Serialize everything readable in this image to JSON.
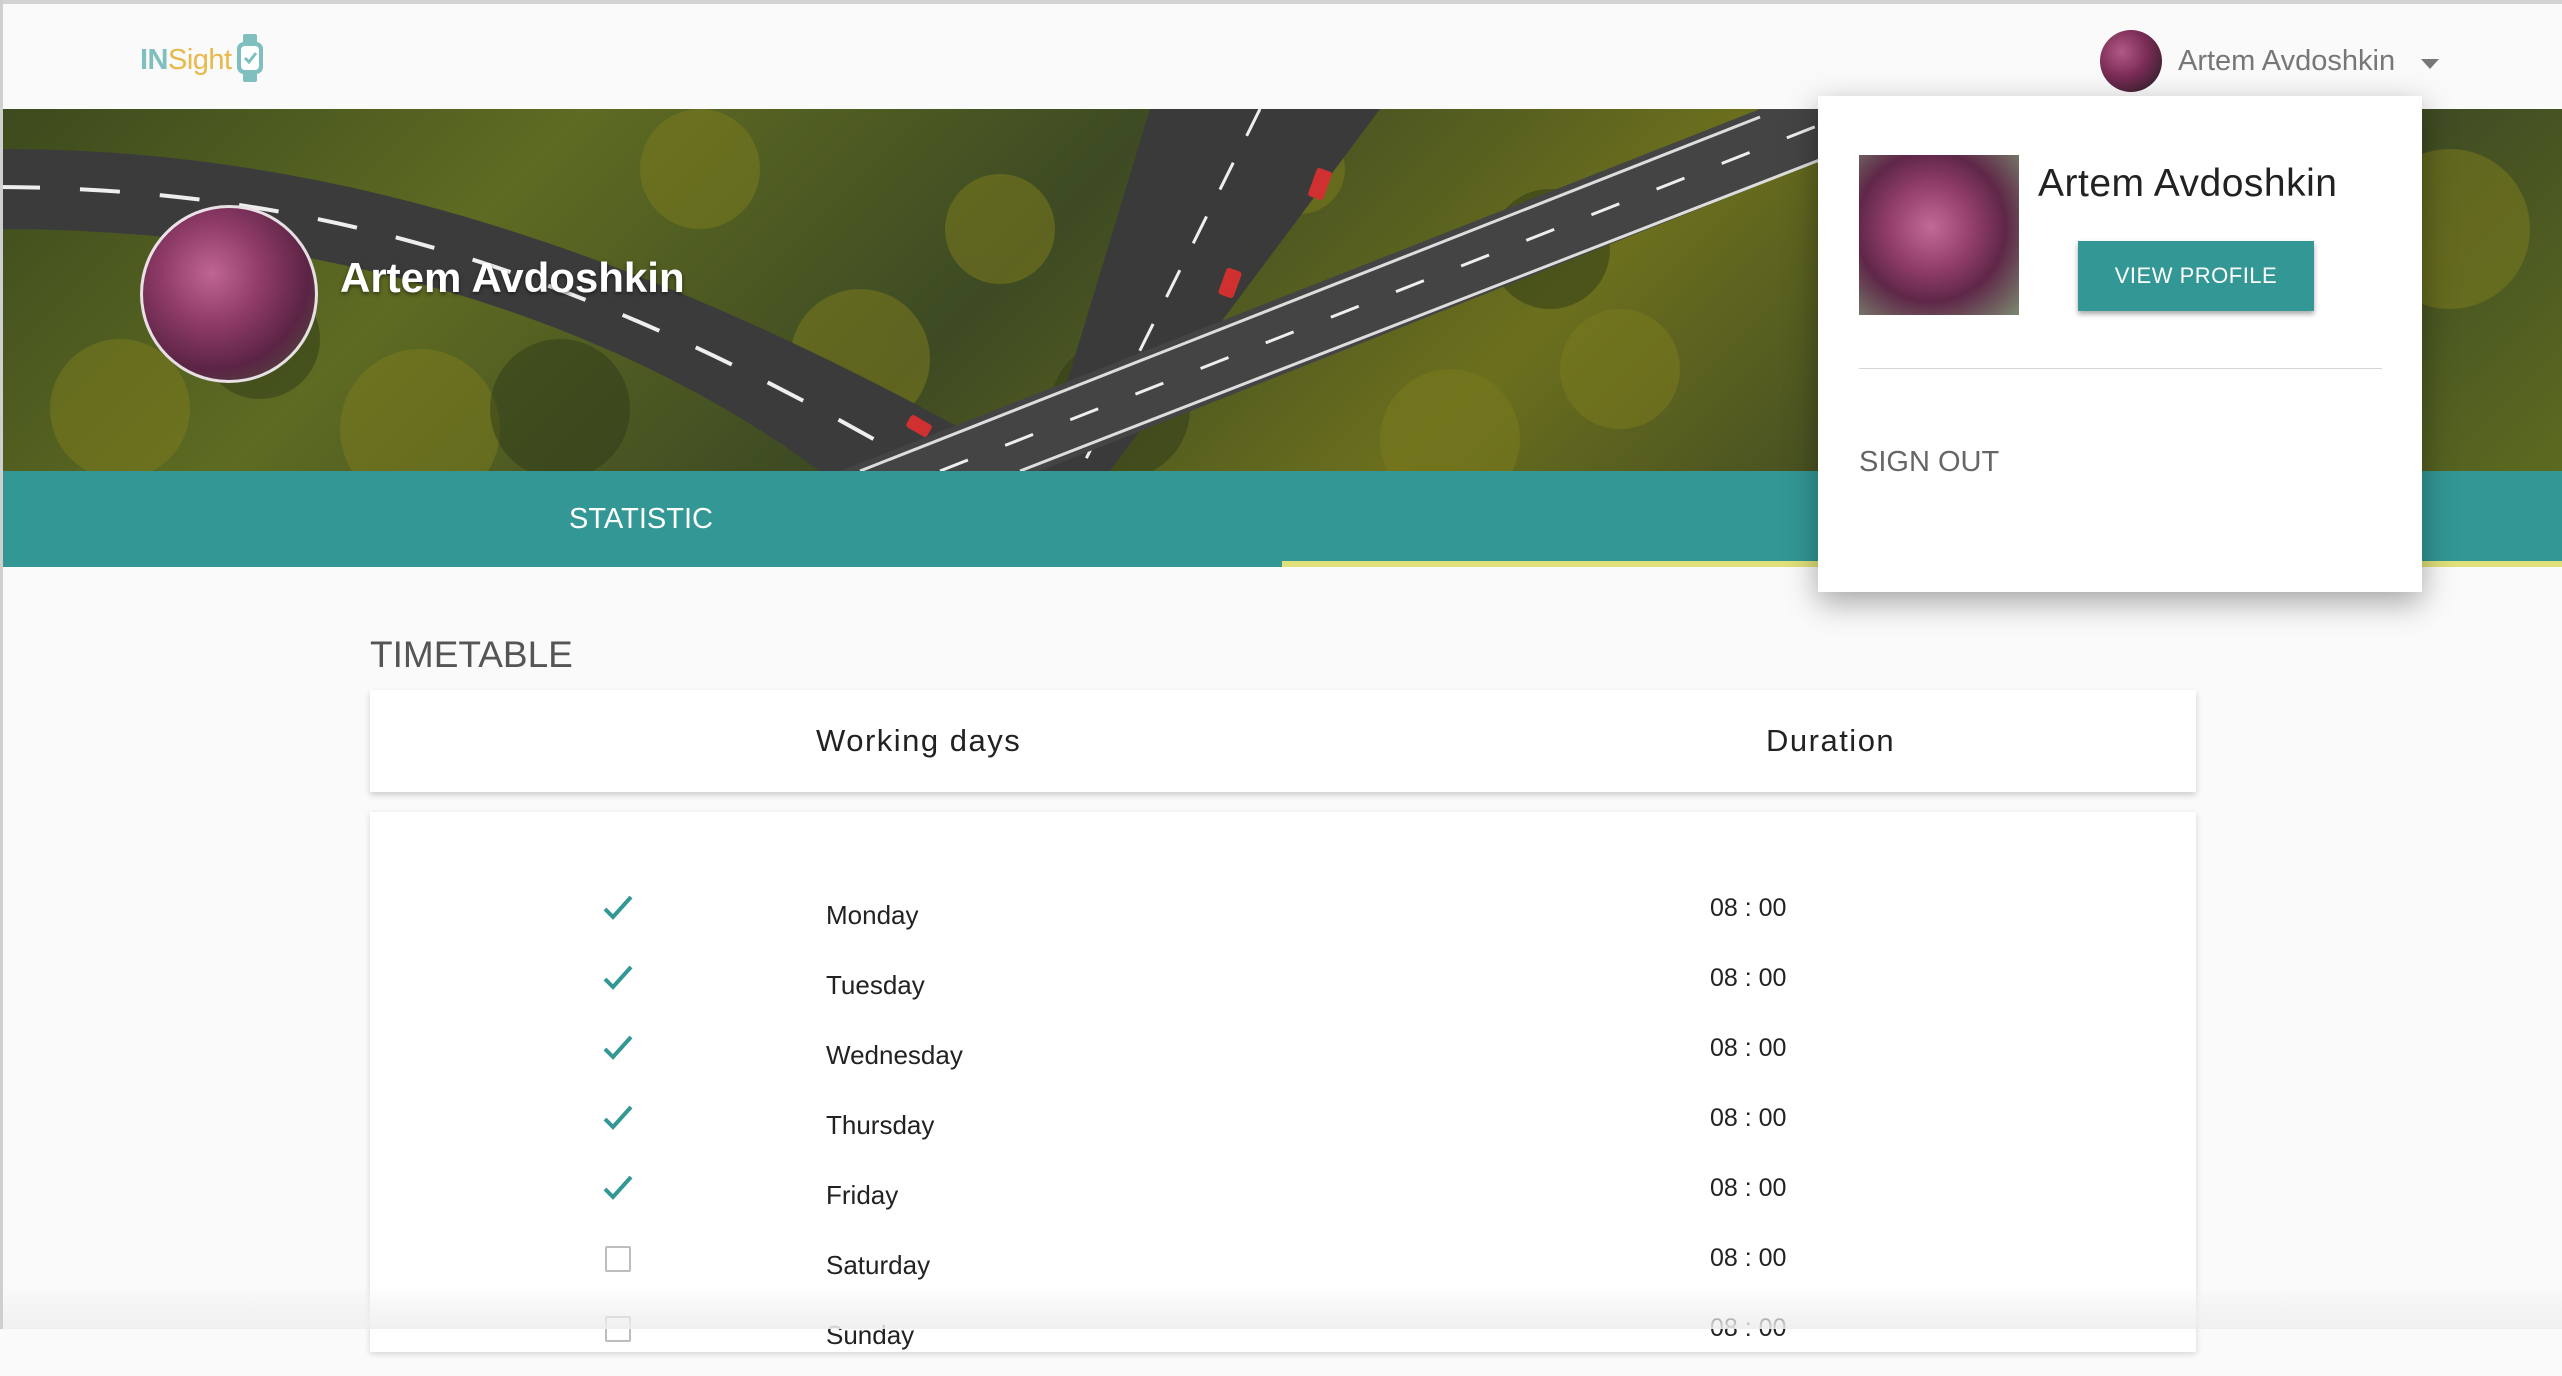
{
  "app": {
    "logo_in": "IN",
    "logo_sight": "Sight"
  },
  "header": {
    "user_name": "Artem Avdoshkin"
  },
  "hero": {
    "user_name": "Artem Avdoshkin"
  },
  "tabs": [
    {
      "label": "STATISTIC",
      "active": false
    },
    {
      "label": "",
      "active": true
    }
  ],
  "timetable": {
    "title": "TIMETABLE",
    "columns": [
      "Working days",
      "Duration"
    ],
    "rows": [
      {
        "day": "Monday",
        "checked": true,
        "duration": "08 : 00"
      },
      {
        "day": "Tuesday",
        "checked": true,
        "duration": "08 : 00"
      },
      {
        "day": "Wednesday",
        "checked": true,
        "duration": "08 : 00"
      },
      {
        "day": "Thursday",
        "checked": true,
        "duration": "08 : 00"
      },
      {
        "day": "Friday",
        "checked": true,
        "duration": "08 : 00"
      },
      {
        "day": "Saturday",
        "checked": false,
        "duration": "08 : 00"
      },
      {
        "day": "Sunday",
        "checked": false,
        "duration": "08 : 00"
      }
    ]
  },
  "dropdown": {
    "name": "Artem Avdoshkin",
    "view_profile": "VIEW PROFILE",
    "sign_out": "SIGN OUT"
  },
  "colors": {
    "accent": "#339795",
    "tab_indicator": "#dfe07a",
    "logo_in": "#7fbfc0",
    "logo_sight": "#e9b84a"
  },
  "icons": {
    "check": "check-icon",
    "caret": "caret-down-icon",
    "watch": "watch-icon"
  }
}
